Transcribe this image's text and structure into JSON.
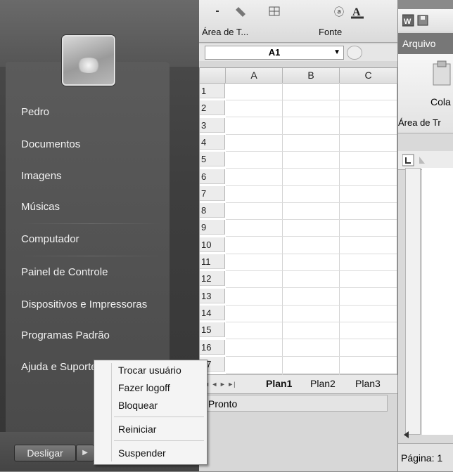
{
  "start_menu": {
    "items": [
      {
        "label": "Pedro"
      },
      {
        "label": "Documentos"
      },
      {
        "label": "Imagens"
      },
      {
        "label": "Músicas"
      },
      {
        "label": "Computador"
      },
      {
        "label": "Painel de Controle"
      },
      {
        "label": "Dispositivos e Impressoras"
      },
      {
        "label": "Programas Padrão"
      },
      {
        "label": "Ajuda e Suporte"
      }
    ],
    "shutdown_label": "Desligar",
    "shutdown_arrow": "▶",
    "power_menu": [
      {
        "label": "Trocar usuário"
      },
      {
        "label": "Fazer logoff"
      },
      {
        "label": "Bloquear"
      },
      {
        "label": "Reiniciar"
      },
      {
        "label": "Suspender"
      }
    ]
  },
  "excel": {
    "group_clipboard": "Área de T...",
    "group_font": "Fonte",
    "name_box": "A1",
    "name_box_arrow": "▼",
    "columns": [
      "A",
      "B",
      "C"
    ],
    "rows": [
      "1",
      "2",
      "3",
      "4",
      "5",
      "6",
      "7",
      "8",
      "9",
      "10",
      "11",
      "12",
      "13",
      "14",
      "15",
      "16",
      "17"
    ],
    "sheet_nav": "◄ ◄ ► ►|",
    "sheets": [
      "Plan1",
      "Plan2",
      "Plan3"
    ],
    "active_sheet": "Plan1",
    "status": "Pronto"
  },
  "word": {
    "menu_file": "Arquivo",
    "paste_label": "Cola",
    "group_clipboard": "Área de Tr",
    "status": "Página: 1"
  },
  "colors": {
    "start_menu_bg": "#3e3e3e",
    "excel_bg": "#d7d7d7",
    "grid_bg": "#ffffff"
  }
}
